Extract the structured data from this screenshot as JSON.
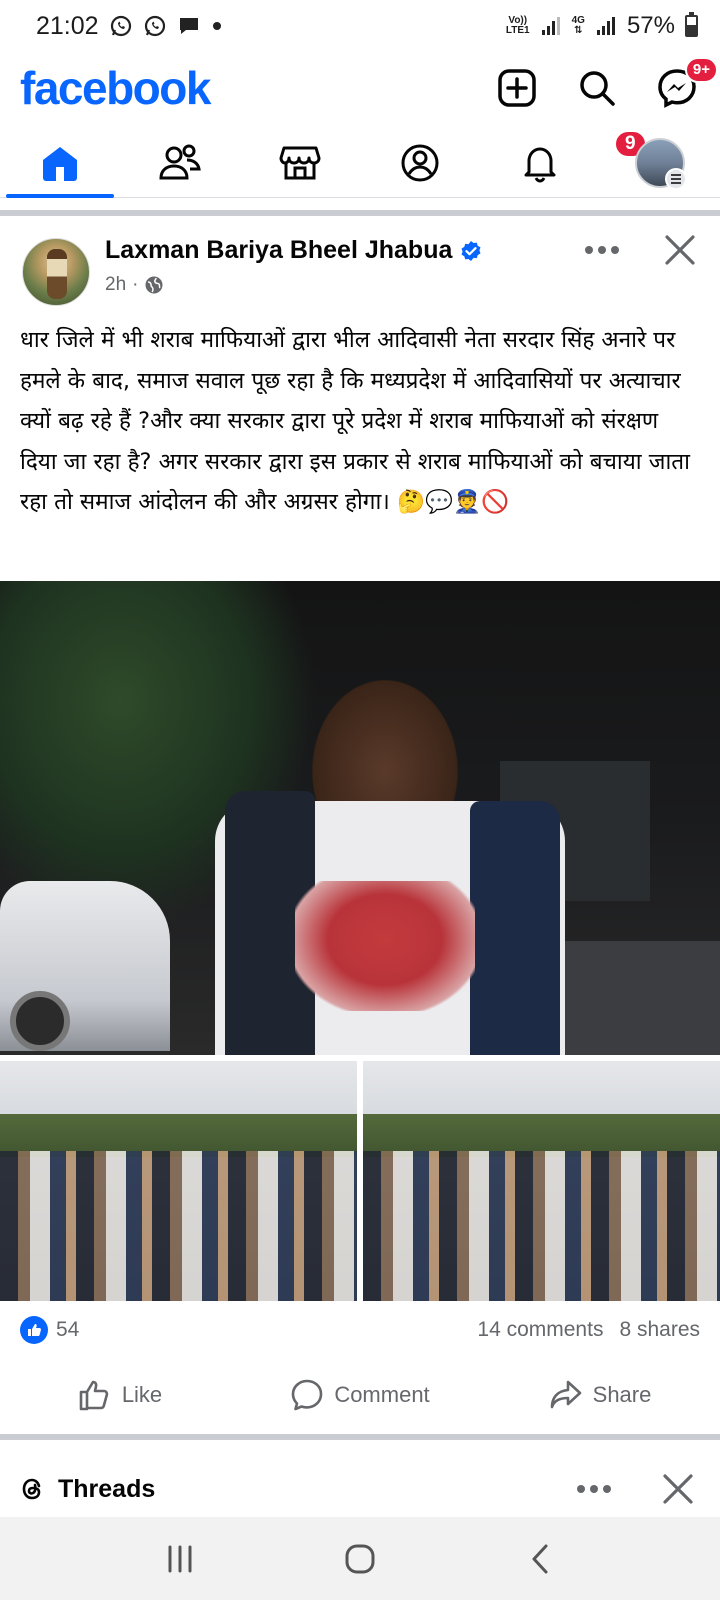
{
  "status_bar": {
    "time": "21:02",
    "notification_icons": [
      "whatsapp-icon",
      "whatsapp-icon",
      "message-icon",
      "dot-icon"
    ],
    "network_label_top": "Vo))",
    "network_label_bottom": "LTE1",
    "data_type": "4G",
    "battery_percent": "57%",
    "battery_level": 0.57
  },
  "header": {
    "logo": "facebook",
    "messenger_badge": "9+",
    "brand_color": "#0866ff"
  },
  "nav": {
    "tabs": [
      "home",
      "friends",
      "marketplace",
      "profile",
      "notifications",
      "menu"
    ],
    "active_tab": "home",
    "notifications_badge": "9"
  },
  "post": {
    "author": "Laxman Bariya Bheel Jhabua",
    "verified": true,
    "time": "2h",
    "separator": "·",
    "text": "धार जिले में भी शराब माफियाओं द्वारा भील आदिवासी नेता सरदार सिंह अनारे पर हमले के बाद, समाज सवाल पूछ रहा है कि मध्यप्रदेश में आदिवासियों पर अत्याचार क्यों बढ़ रहे हैं ?और क्या सरकार द्वारा पूरे प्रदेश में शराब माफियाओं को संरक्षण दिया जा रहा है? अगर सरकार द्वारा इस प्रकार से शराब माफियाओं को बचाया जाता रहा तो समाज आंदोलन की और अग्रसर होगा। 🤔💬👮🚫",
    "reaction_count": "54",
    "comments": "14 comments",
    "shares": "8 shares",
    "actions": {
      "like": "Like",
      "comment": "Comment",
      "share": "Share"
    }
  },
  "next_section": {
    "label": "Threads"
  }
}
